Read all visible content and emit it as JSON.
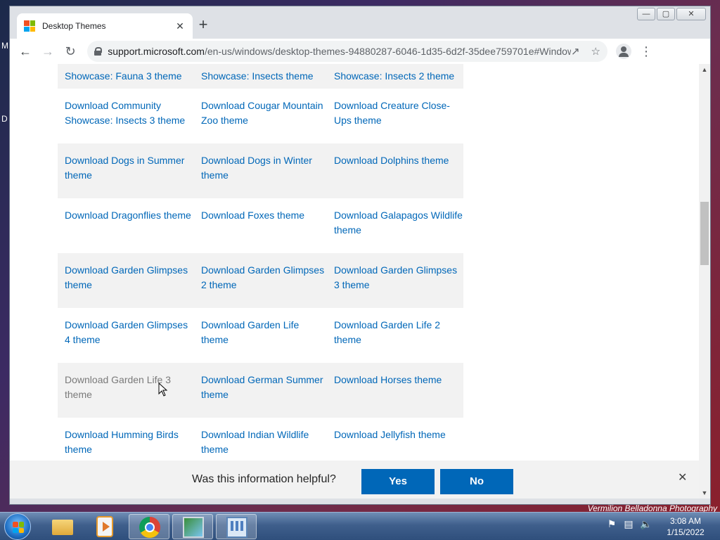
{
  "desktop": {
    "left_letters": [
      "M",
      "D"
    ]
  },
  "browser": {
    "tab_title": "Desktop Themes",
    "tab_close": "✕",
    "new_tab": "+",
    "url_host": "support.microsoft.com",
    "url_path": "/en-us/windows/desktop-themes-94880287-6046-1d35-6d2f-35dee759701e#WindowsVer...",
    "window_controls": {
      "minimize": "—",
      "maximize": "▢",
      "close": "✕"
    }
  },
  "themes": {
    "first_row": [
      "Showcase: Fauna 3 theme",
      "Showcase: Insects theme",
      "Showcase: Insects 2 theme"
    ],
    "rows": [
      [
        "Download Community Showcase: Insects 3 theme",
        "Download Cougar Mountain Zoo theme",
        "Download Creature Close-Ups theme"
      ],
      [
        "Download Dogs in Summer theme",
        "Download Dogs in Winter theme",
        "Download Dolphins theme"
      ],
      [
        "Download Dragonflies theme",
        "Download Foxes theme",
        "Download Galapagos Wildlife theme"
      ],
      [
        "Download Garden Glimpses theme",
        "Download Garden Glimpses 2 theme",
        "Download Garden Glimpses 3 theme"
      ],
      [
        "Download Garden Glimpses 4 theme",
        "Download Garden Life theme",
        "Download Garden Life 2 theme"
      ],
      [
        "Download Garden Life 3 theme",
        "Download German Summer theme",
        "Download Horses theme"
      ],
      [
        "Download Humming Birds theme",
        "Download Indian Wildlife theme",
        "Download Jellyfish theme"
      ]
    ]
  },
  "feedback": {
    "question": "Was this information helpful?",
    "yes": "Yes",
    "no": "No",
    "close": "✕"
  },
  "wallpaper_caption": "Vermilion Belladonna Photography",
  "taskbar": {
    "time": "3:08 AM",
    "date": "1/15/2022"
  },
  "colors": {
    "link": "#0067b8",
    "visited": "#7a7a7a",
    "button": "#0067b8"
  }
}
